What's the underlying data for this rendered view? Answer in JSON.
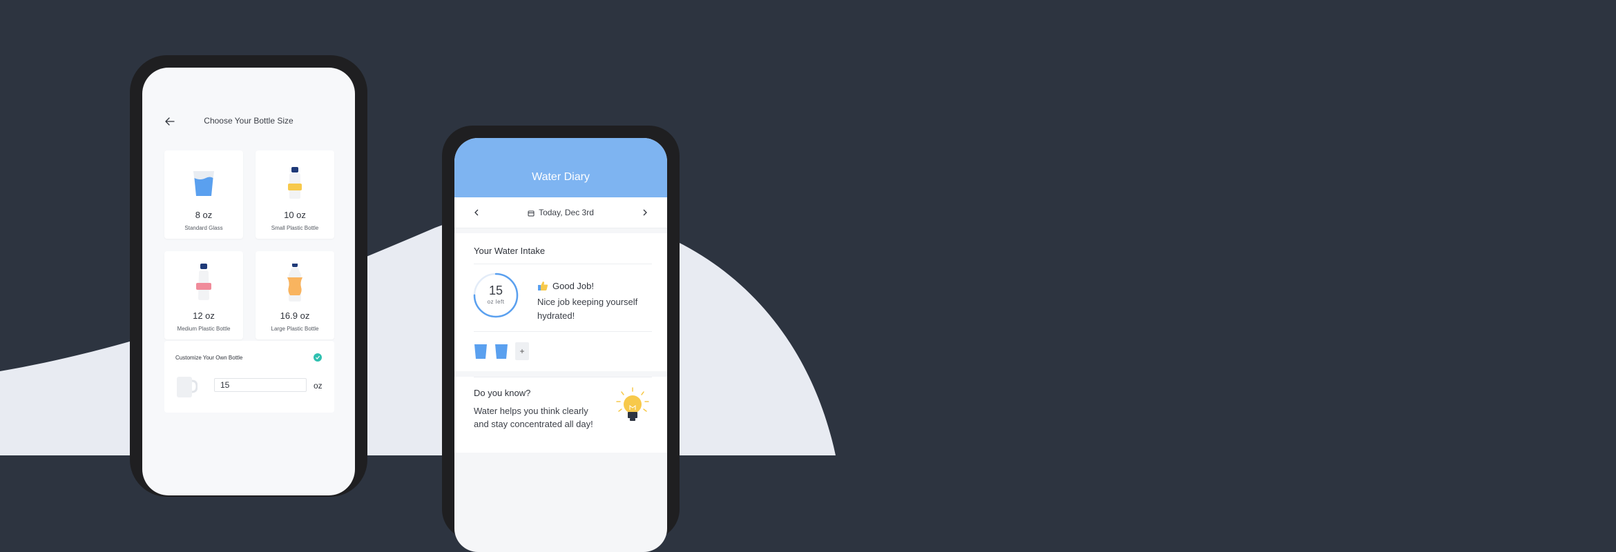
{
  "colors": {
    "background": "#2d3440",
    "curve": "#e8ebf2",
    "accent_blue": "#7eb4f1",
    "glass_blue": "#5aa0ef",
    "bottle_yellow": "#f7c94b",
    "bottle_pink": "#f08b9a",
    "bottle_orange": "#f9b45f",
    "cap_navy": "#1f3a78",
    "check_teal": "#2fc0b0",
    "bulb_yellow": "#f7c94b"
  },
  "bottle_screen": {
    "back_icon": "arrow-left-icon",
    "title": "Choose Your Bottle Size",
    "options": [
      {
        "size": "8 oz",
        "name": "Standard Glass",
        "icon": "glass-icon"
      },
      {
        "size": "10 oz",
        "name": "Small Plastic Bottle",
        "icon": "small-bottle-icon"
      },
      {
        "size": "12 oz",
        "name": "Medium Plastic Bottle",
        "icon": "medium-bottle-icon"
      },
      {
        "size": "16.9 oz",
        "name": "Large Plastic Bottle",
        "icon": "large-bottle-icon"
      }
    ],
    "custom": {
      "title": "Customize Your Own Bottle",
      "value": "15",
      "unit": "oz",
      "check_icon": "check-icon",
      "cup_icon": "cup-icon"
    }
  },
  "diary_screen": {
    "title": "Water Diary",
    "date": "Today, Dec 3rd",
    "intake": {
      "title": "Your Water Intake",
      "remaining": "15",
      "remaining_label": "oz left",
      "progress": 0.75,
      "status_title": "Good Job!",
      "status_text": "Nice job keeping yourself hydrated!",
      "glasses_logged": 2,
      "add_label": "+"
    },
    "tip": {
      "title": "Do you know?",
      "text": "Water helps you think clearly and stay concentrated all day!",
      "icon": "lightbulb-icon"
    }
  }
}
